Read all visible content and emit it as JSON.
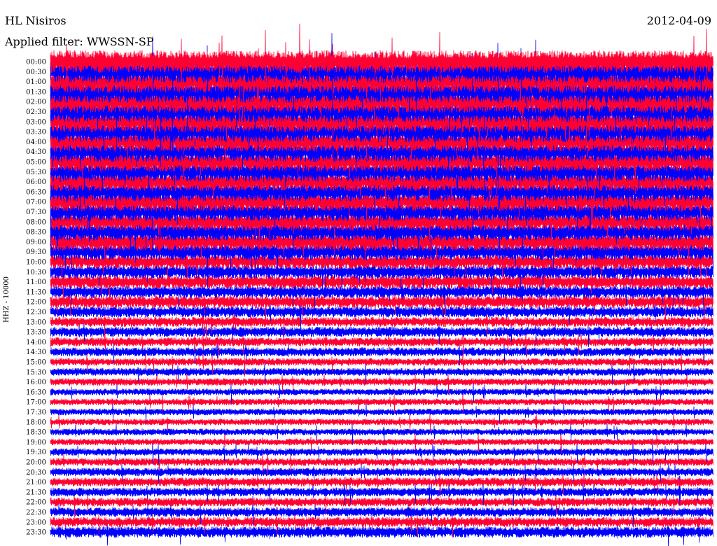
{
  "header": {
    "station": "HL Nisiros",
    "filter": "Applied filter: WWSSN-SP",
    "date": "2012-04-09"
  },
  "axis": {
    "ylabel": "HHZ - 10000"
  },
  "colors": {
    "trace_a": "#0000ff",
    "trace_b": "#ff0033",
    "background": "#ffffff",
    "text": "#000000"
  },
  "chart_data": {
    "type": "line",
    "title": "HL Nisiros",
    "subtitle": "Applied filter: WWSSN-SP",
    "ylabel": "HHZ - 10000",
    "xlabel": "",
    "row_labels": [
      "00:00",
      "00:30",
      "01:00",
      "01:30",
      "02:00",
      "02:30",
      "03:00",
      "03:30",
      "04:00",
      "04:30",
      "05:00",
      "05:30",
      "06:00",
      "06:30",
      "07:00",
      "07:30",
      "08:00",
      "08:30",
      "09:00",
      "09:30",
      "10:00",
      "10:30",
      "11:00",
      "11:30",
      "12:00",
      "12:30",
      "13:00",
      "13:30",
      "14:00",
      "14:30",
      "15:00",
      "15:30",
      "16:00",
      "16:30",
      "17:00",
      "17:30",
      "18:00",
      "18:30",
      "19:00",
      "19:30",
      "20:00",
      "20:30",
      "21:00",
      "21:30",
      "22:00",
      "22:30",
      "23:00",
      "23:30"
    ],
    "row_colors": [
      "#ff0033",
      "#0000ff"
    ],
    "relative_amplitude": [
      1.0,
      1.0,
      1.0,
      1.0,
      1.0,
      0.95,
      0.95,
      0.95,
      0.9,
      0.9,
      0.9,
      0.9,
      0.85,
      0.85,
      0.85,
      0.85,
      0.8,
      0.8,
      0.8,
      0.75,
      0.65,
      0.6,
      0.6,
      0.55,
      0.55,
      0.5,
      0.45,
      0.45,
      0.4,
      0.4,
      0.35,
      0.35,
      0.33,
      0.3,
      0.3,
      0.3,
      0.3,
      0.3,
      0.3,
      0.33,
      0.35,
      0.38,
      0.4,
      0.4,
      0.4,
      0.42,
      0.45,
      0.5
    ],
    "grid": false,
    "legend": "none"
  }
}
